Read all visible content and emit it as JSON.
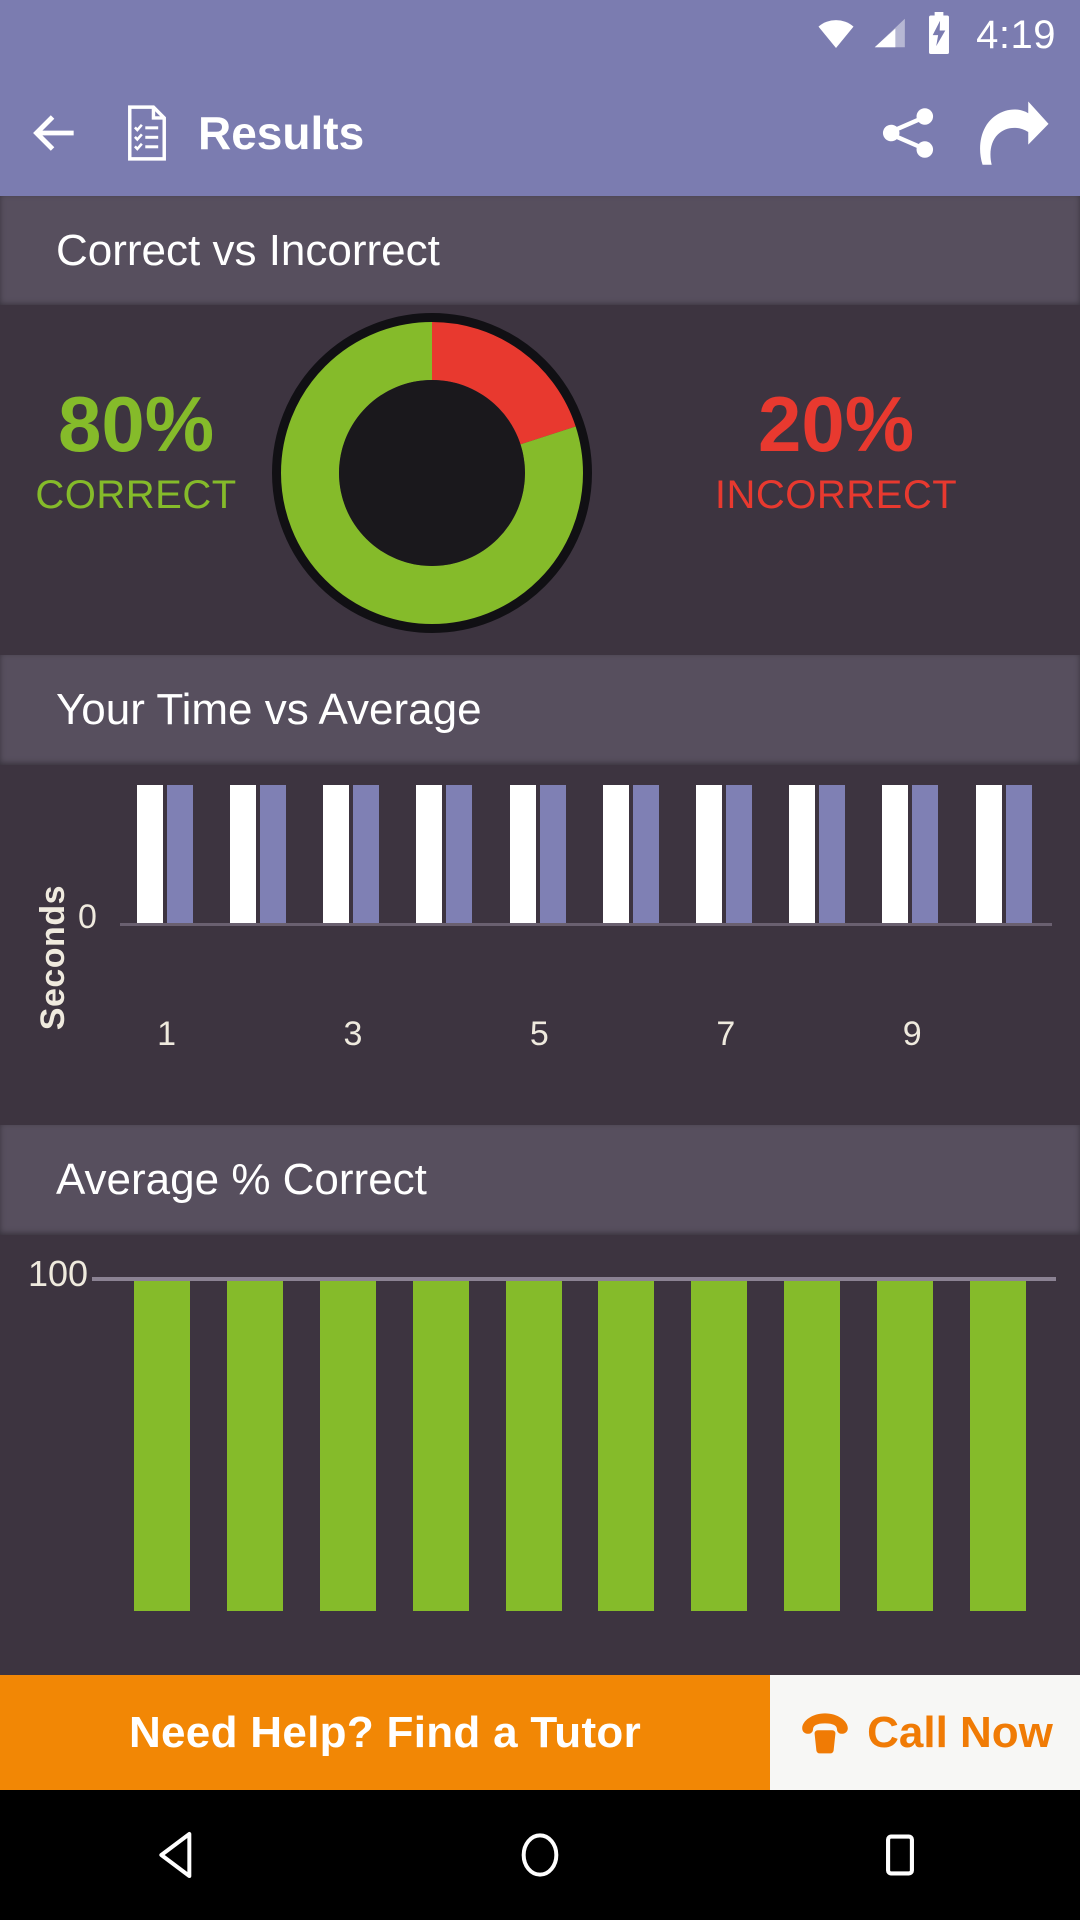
{
  "status_bar": {
    "clock": "4:19",
    "icons": [
      "wifi-icon",
      "cellular-signal-icon",
      "battery-charging-icon"
    ],
    "background": "#7b7cb0"
  },
  "app_bar": {
    "back_label": "back-arrow",
    "doc_icon": "checklist-document-icon",
    "title": "Results",
    "actions": [
      {
        "name": "share-button",
        "icon": "share-icon"
      },
      {
        "name": "next-button",
        "icon": "curved-arrow-icon"
      }
    ]
  },
  "sections": [
    {
      "title": "Correct vs Incorrect"
    },
    {
      "title": "Your Time vs Average"
    },
    {
      "title": "Average % Correct"
    }
  ],
  "donut": {
    "correct_value": "80%",
    "correct_label": "CORRECT",
    "incorrect_value": "20%",
    "incorrect_label": "INCORRECT",
    "correct_color": "#85bb2a",
    "incorrect_color": "#e8392f"
  },
  "ad": {
    "headline": "Need Help? Find a Tutor",
    "cta_label": "Call Now",
    "cta_icon": "phone-icon",
    "background": "#f28705",
    "cta_background": "#f7f7f5",
    "cta_text_color": "#f07b05"
  },
  "nav_bar": {
    "back": "nav-back-triangle-icon",
    "home": "nav-home-circle-icon",
    "recents": "nav-recents-square-icon"
  },
  "chart_data": [
    {
      "type": "bar",
      "title": "Correct vs Incorrect",
      "subtype": "donut",
      "categories": [
        "Correct",
        "Incorrect"
      ],
      "values": [
        80,
        20
      ],
      "labels": [
        "80%",
        "20%"
      ],
      "colors": [
        "#85bb2a",
        "#e8392f"
      ],
      "start_angle_deg": 0,
      "direction": "clockwise",
      "legend": "side-labels"
    },
    {
      "type": "bar",
      "title": "Your Time vs Average",
      "xlabel": "",
      "ylabel": "Seconds",
      "ylim": [
        0,
        1
      ],
      "ytick_labels": [
        "0"
      ],
      "ytick_values": [
        0
      ],
      "categories": [
        "1",
        "2",
        "3",
        "4",
        "5",
        "6",
        "7",
        "8",
        "9",
        "10"
      ],
      "xtick_labels": [
        "1",
        "3",
        "5",
        "7",
        "9"
      ],
      "xtick_positions": [
        1,
        3,
        5,
        7,
        9
      ],
      "grid": false,
      "legend": "none",
      "series": [
        {
          "name": "Your Time",
          "color": "#ffffff",
          "values": [
            1,
            1,
            1,
            1,
            1,
            1,
            1,
            1,
            1,
            1
          ]
        },
        {
          "name": "Average",
          "color": "#7f80b4",
          "values": [
            1,
            1,
            1,
            1,
            1,
            1,
            1,
            1,
            1,
            1
          ]
        }
      ]
    },
    {
      "type": "bar",
      "title": "Average % Correct",
      "xlabel": "",
      "ylabel": "",
      "ylim": [
        0,
        100
      ],
      "ytick_labels": [
        "100"
      ],
      "ytick_values": [
        100
      ],
      "categories": [
        "1",
        "2",
        "3",
        "4",
        "5",
        "6",
        "7",
        "8",
        "9",
        "10"
      ],
      "grid": true,
      "legend": "none",
      "values": [
        100,
        100,
        100,
        100,
        100,
        100,
        100,
        100,
        100,
        100
      ],
      "color": "#85bb2a"
    }
  ]
}
